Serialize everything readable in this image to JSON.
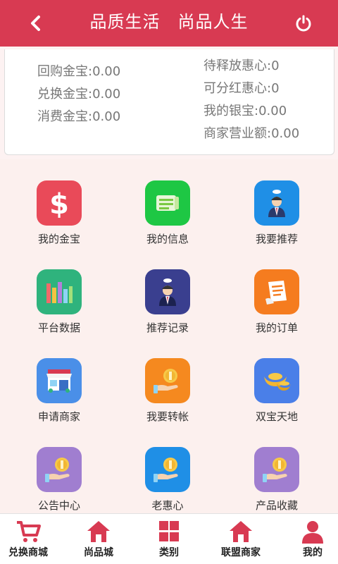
{
  "header": {
    "title": "品质生活　尚品人生",
    "color": "#d83a52"
  },
  "summary": {
    "left": [
      {
        "label": "回购金宝:0.00"
      },
      {
        "label": "兑换金宝:0.00"
      },
      {
        "label": "消费金宝:0.00"
      }
    ],
    "right": [
      {
        "label": "待释放惠心:0"
      },
      {
        "label": "可分红惠心:0"
      },
      {
        "label": "我的银宝:0.00"
      },
      {
        "label": "商家营业额:0.00"
      }
    ]
  },
  "menu": [
    {
      "label": "我的金宝",
      "icon": "dollar-icon",
      "color": "#e94a59"
    },
    {
      "label": "我的信息",
      "icon": "message-icon",
      "color": "#1ec744"
    },
    {
      "label": "我要推荐",
      "icon": "recommend-person-icon",
      "color": "#1f8fe6"
    },
    {
      "label": "平台数据",
      "icon": "bar-chart-icon",
      "color": "#2fb37d"
    },
    {
      "label": "推荐记录",
      "icon": "referral-record-icon",
      "color": "#3a3f8f"
    },
    {
      "label": "我的订单",
      "icon": "order-list-icon",
      "color": "#f57c1f"
    },
    {
      "label": "申请商家",
      "icon": "storefront-icon",
      "color": "#4a8fe8"
    },
    {
      "label": "我要转帐",
      "icon": "coin-hand-icon",
      "color": "#f5891f"
    },
    {
      "label": "双宝天地",
      "icon": "gold-ingot-icon",
      "color": "#4a7fe8"
    },
    {
      "label": "公告中心",
      "icon": "coin-hand-icon",
      "color": "#a07ed0"
    },
    {
      "label": "老惠心",
      "icon": "coin-hand-icon",
      "color": "#1f8fe6"
    },
    {
      "label": "产品收藏",
      "icon": "coin-hand-icon",
      "color": "#a07ed0"
    }
  ],
  "tabs": [
    {
      "label": "兑换商城",
      "icon": "cart-icon"
    },
    {
      "label": "尚品城",
      "icon": "home-icon"
    },
    {
      "label": "类别",
      "icon": "grid-icon"
    },
    {
      "label": "联盟商家",
      "icon": "home-icon"
    },
    {
      "label": "我的",
      "icon": "user-icon"
    }
  ],
  "accent": "#d83a52"
}
